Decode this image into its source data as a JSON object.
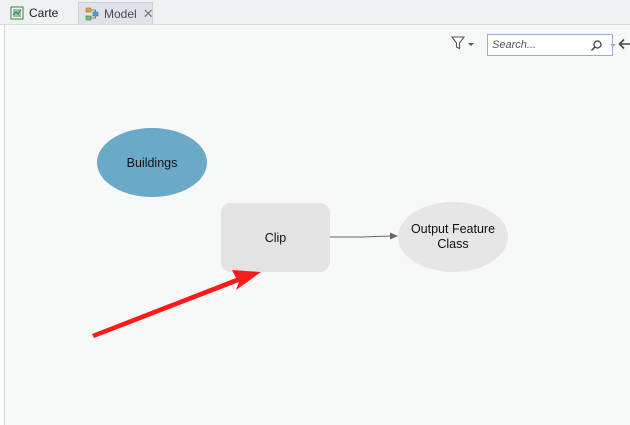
{
  "tabs": [
    {
      "label": "Carte",
      "icon": "map-icon"
    },
    {
      "label": "Model",
      "icon": "model-icon",
      "close": "✕"
    }
  ],
  "toolbar": {
    "search_placeholder": "Search...",
    "filter_icon": "filter-icon",
    "search_icon": "search-icon",
    "back_icon": "back-arrow-icon"
  },
  "diagram": {
    "nodes": {
      "buildings": "Buildings",
      "clip": "Clip",
      "output": "Output Feature Class"
    }
  },
  "colors": {
    "buildings_fill": "#6aa9c8",
    "clip_fill": "#e3e3e3",
    "output_fill": "#e6e6e6",
    "annotation_arrow": "#ff1a1a"
  }
}
